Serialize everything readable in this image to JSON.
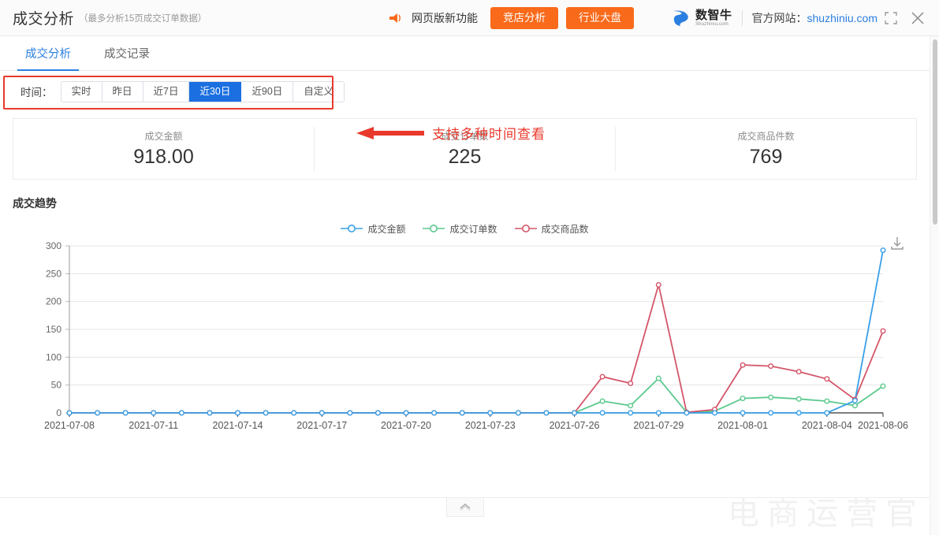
{
  "titlebar": {
    "title": "成交分析",
    "subtitle": "（最多分析15页成交订单数据）",
    "feature_label": "网页版新功能",
    "btn_compete": "竞店分析",
    "btn_industry": "行业大盘",
    "brand_name": "数智牛",
    "brand_sub": "Shuzhiniu.com",
    "site_label": "官方网站：",
    "site_link": "shuzhiniu.com",
    "icon_horn": "horn-icon",
    "icon_fullscreen": "fullscreen-icon",
    "icon_close": "close-icon",
    "accent_orange": "#f96a1b",
    "accent_blue": "#2a7fe0"
  },
  "tabs": [
    {
      "label": "成交分析",
      "active": true
    },
    {
      "label": "成交记录",
      "active": false
    }
  ],
  "filter": {
    "label": "时间：",
    "options": [
      {
        "label": "实时",
        "active": false
      },
      {
        "label": "昨日",
        "active": false
      },
      {
        "label": "近7日",
        "active": false
      },
      {
        "label": "近30日",
        "active": true
      },
      {
        "label": "近90日",
        "active": false
      },
      {
        "label": "自定义",
        "active": false
      }
    ],
    "highlight_color": "#e8392c",
    "active_color": "#1b6fe0"
  },
  "annotation": {
    "text": "支持多种时间查看",
    "color": "#e8392c"
  },
  "kpis": [
    {
      "label": "成交金额",
      "value": "918.00"
    },
    {
      "label": "成交订单数",
      "value": "225"
    },
    {
      "label": "成交商品件数",
      "value": "769"
    }
  ],
  "chart_section": {
    "title": "成交趋势",
    "download_icon": "download-icon"
  },
  "chart_data": {
    "type": "line",
    "title": "成交趋势",
    "xlabel": "",
    "ylabel": "",
    "ylim": [
      0,
      300
    ],
    "yticks": [
      0,
      50,
      100,
      150,
      200,
      250,
      300
    ],
    "grid": true,
    "legend_position": "top-center",
    "x": [
      "2021-07-08",
      "2021-07-09",
      "2021-07-10",
      "2021-07-11",
      "2021-07-12",
      "2021-07-13",
      "2021-07-14",
      "2021-07-15",
      "2021-07-16",
      "2021-07-17",
      "2021-07-18",
      "2021-07-19",
      "2021-07-20",
      "2021-07-21",
      "2021-07-22",
      "2021-07-23",
      "2021-07-24",
      "2021-07-25",
      "2021-07-26",
      "2021-07-27",
      "2021-07-28",
      "2021-07-29",
      "2021-07-30",
      "2021-07-31",
      "2021-08-01",
      "2021-08-02",
      "2021-08-03",
      "2021-08-04",
      "2021-08-05",
      "2021-08-06"
    ],
    "xtick_labels": [
      "2021-07-08",
      "2021-07-11",
      "2021-07-14",
      "2021-07-17",
      "2021-07-20",
      "2021-07-23",
      "2021-07-26",
      "2021-07-29",
      "2021-08-01",
      "2021-08-04",
      "2021-08-06"
    ],
    "series": [
      {
        "name": "成交金额",
        "color": "#3aa0e8",
        "values": [
          0,
          0,
          0,
          0,
          0,
          0,
          0,
          0,
          0,
          0,
          0,
          0,
          0,
          0,
          0,
          0,
          0,
          0,
          0,
          0,
          0,
          0,
          0,
          0,
          0,
          0,
          0,
          0,
          22,
          292
        ]
      },
      {
        "name": "成交订单数",
        "color": "#5cc98d",
        "values": [
          0,
          0,
          0,
          0,
          0,
          0,
          0,
          0,
          0,
          0,
          0,
          0,
          0,
          0,
          0,
          0,
          0,
          0,
          0,
          21,
          13,
          62,
          1,
          3,
          26,
          28,
          25,
          21,
          13,
          48
        ]
      },
      {
        "name": "成交商品数",
        "color": "#d4566a",
        "values": [
          0,
          0,
          0,
          0,
          0,
          0,
          0,
          0,
          0,
          0,
          0,
          0,
          0,
          0,
          0,
          0,
          0,
          0,
          0,
          65,
          53,
          230,
          1,
          6,
          86,
          84,
          74,
          61,
          24,
          147
        ]
      }
    ]
  },
  "bottom": {
    "collapse_icon": "chevron-up-icon",
    "watermark": "电商运营官"
  }
}
